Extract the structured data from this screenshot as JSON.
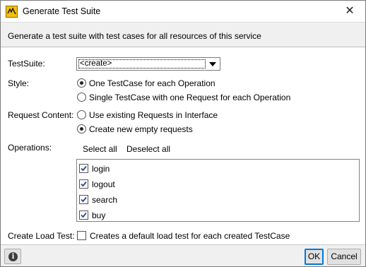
{
  "window": {
    "title": "Generate Test Suite",
    "close_glyph": "✕"
  },
  "header": {
    "description": "Generate a test suite with test cases for all resources of this service"
  },
  "form": {
    "testsuite_label": "TestSuite:",
    "testsuite_value": "<create>",
    "style_label": "Style:",
    "style_options": [
      {
        "label": "One TestCase for each Operation",
        "selected": true
      },
      {
        "label": "Single TestCase with one Request for each Operation",
        "selected": false
      }
    ],
    "request_content_label": "Request Content:",
    "request_content_options": [
      {
        "label": "Use existing Requests in Interface",
        "selected": false
      },
      {
        "label": "Create new empty requests",
        "selected": true
      }
    ],
    "operations_label": "Operations:",
    "select_all_label": "Select all",
    "deselect_all_label": "Deselect all",
    "operations": [
      {
        "name": "login",
        "checked": true
      },
      {
        "name": "logout",
        "checked": true
      },
      {
        "name": "search",
        "checked": true
      },
      {
        "name": "buy",
        "checked": true
      }
    ],
    "load_test_label": "Create Load Test:",
    "load_test_option": "Creates a default load test for each created TestCase",
    "load_test_checked": false
  },
  "footer": {
    "info_glyph": "i",
    "ok_label": "OK",
    "cancel_label": "Cancel"
  }
}
